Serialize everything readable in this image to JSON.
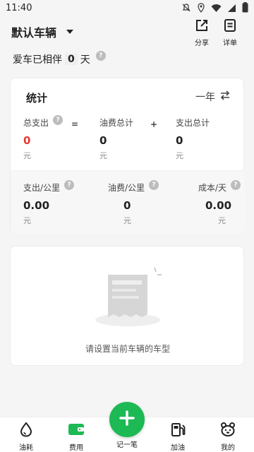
{
  "status_bar": {
    "time": "11:40"
  },
  "header": {
    "car_name": "默认车辆",
    "share_label": "分享",
    "detail_label": "详单"
  },
  "together": {
    "prefix": "爱车已相伴",
    "days": "0",
    "suffix": "天",
    "help": "?"
  },
  "stats": {
    "title": "统计",
    "period": "一年",
    "total_expense": {
      "label": "总支出",
      "value": "0",
      "unit": "元"
    },
    "op_equal": "=",
    "fuel_total": {
      "label": "油费总计",
      "value": "0",
      "unit": "元"
    },
    "op_plus": "+",
    "expense_total": {
      "label": "支出总计",
      "value": "0",
      "unit": "元"
    },
    "expense_per_km": {
      "label": "支出/公里",
      "value": "0.00",
      "unit": "元"
    },
    "fuel_per_km": {
      "label": "油费/公里",
      "value": "0",
      "unit": "元"
    },
    "cost_per_day": {
      "label": "成本/天",
      "value": "0.00",
      "unit": "元"
    }
  },
  "empty_state": {
    "message": "请设置当前车辆的车型"
  },
  "bottom_nav": {
    "fuel": "油耗",
    "cost": "费用",
    "add": "记一笔",
    "refuel": "加油",
    "mine": "我的"
  },
  "colors": {
    "accent": "#1db954",
    "negative": "#e53935"
  }
}
